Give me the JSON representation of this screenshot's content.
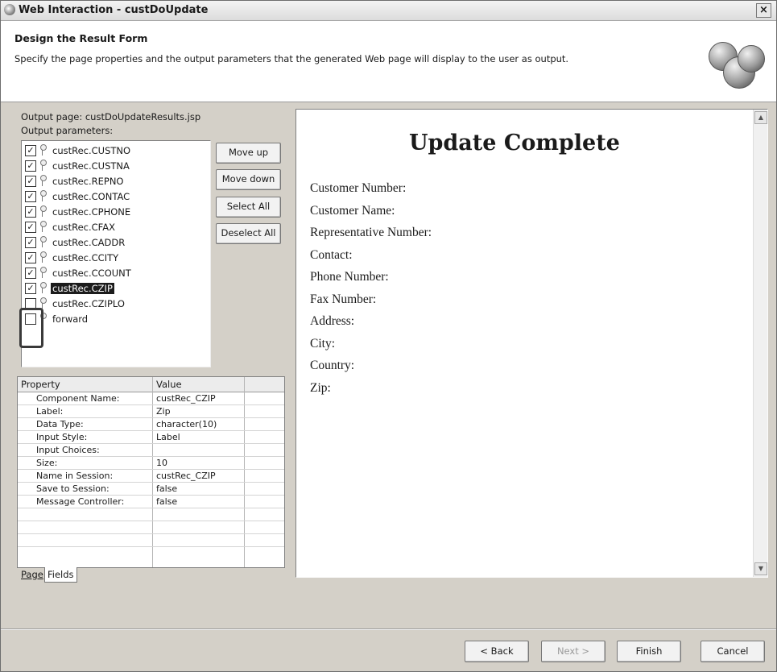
{
  "window": {
    "title": "Web Interaction - custDoUpdate",
    "close_glyph": "×"
  },
  "header": {
    "title": "Design the Result Form",
    "description": "Specify the page properties and the output parameters that the generated Web page will display to the user as output."
  },
  "output_page_label": "Output page: custDoUpdateResults.jsp",
  "output_params_label": "Output parameters:",
  "params": [
    {
      "label": "custRec.CUSTNO",
      "checked": true
    },
    {
      "label": "custRec.CUSTNA",
      "checked": true
    },
    {
      "label": "custRec.REPNO",
      "checked": true
    },
    {
      "label": "custRec.CONTAC",
      "checked": true
    },
    {
      "label": "custRec.CPHONE",
      "checked": true
    },
    {
      "label": "custRec.CFAX",
      "checked": true
    },
    {
      "label": "custRec.CADDR",
      "checked": true
    },
    {
      "label": "custRec.CCITY",
      "checked": true
    },
    {
      "label": "custRec.CCOUNT",
      "checked": true
    },
    {
      "label": "custRec.CZIP",
      "checked": true,
      "selected": true
    },
    {
      "label": "custRec.CZIPLO",
      "checked": false
    },
    {
      "label": "forward",
      "checked": false
    }
  ],
  "side_buttons": {
    "move_up": "Move up",
    "move_down": "Move down",
    "select_all": "Select All",
    "deselect_all": "Deselect All"
  },
  "properties": {
    "headers": {
      "property": "Property",
      "value": "Value"
    },
    "rows": [
      {
        "property": "Component Name:",
        "value": "custRec_CZIP"
      },
      {
        "property": "Label:",
        "value": "Zip"
      },
      {
        "property": "Data Type:",
        "value": "character(10)"
      },
      {
        "property": "Input Style:",
        "value": "Label"
      },
      {
        "property": "Input Choices:",
        "value": ""
      },
      {
        "property": "Size:",
        "value": "10"
      },
      {
        "property": "Name in Session:",
        "value": "custRec_CZIP"
      },
      {
        "property": "Save to Session:",
        "value": "false"
      },
      {
        "property": "Message Controller:",
        "value": "false"
      },
      {
        "property": "",
        "value": ""
      },
      {
        "property": "",
        "value": ""
      },
      {
        "property": "",
        "value": ""
      }
    ]
  },
  "tabs": {
    "page": "Page",
    "fields": "Fields"
  },
  "preview": {
    "heading": "Update Complete",
    "fields": [
      "Customer Number:",
      "Customer Name:",
      "Representative Number:",
      "Contact:",
      "Phone Number:",
      "Fax Number:",
      "Address:",
      "City:",
      "Country:",
      "Zip:"
    ],
    "scroll_up_glyph": "▲",
    "scroll_down_glyph": "▼"
  },
  "footer": {
    "back": "< Back",
    "next": "Next >",
    "finish": "Finish",
    "cancel": "Cancel"
  }
}
